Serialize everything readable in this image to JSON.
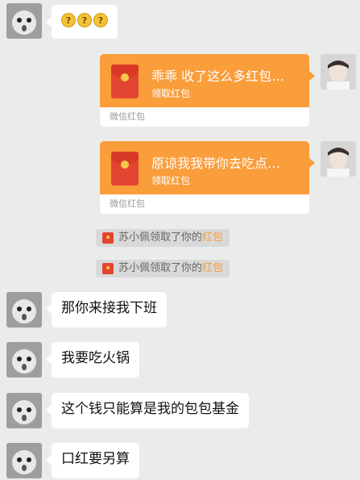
{
  "messages": {
    "m1": {
      "emojis": [
        "?",
        "?",
        "?"
      ]
    },
    "p1": {
      "title": "乖乖 收了这么多红包…",
      "action": "领取红包",
      "footer": "微信红包"
    },
    "p2": {
      "title": "原谅我我带你去吃点…",
      "action": "领取红包",
      "footer": "微信红包"
    },
    "n1": {
      "prefix": "苏小佩领取了你的",
      "highlight": "红包"
    },
    "n2": {
      "prefix": "苏小佩领取了你的",
      "highlight": "红包"
    },
    "t1": "那你来接我下班",
    "t2": "我要吃火锅",
    "t3": "这个钱只能算是我的包包基金",
    "t4": "口红要另算"
  },
  "colors": {
    "background": "#ebebeb",
    "packet": "#fa9d3b",
    "highlight": "#fa9d3b",
    "envelope": "#e24632"
  }
}
